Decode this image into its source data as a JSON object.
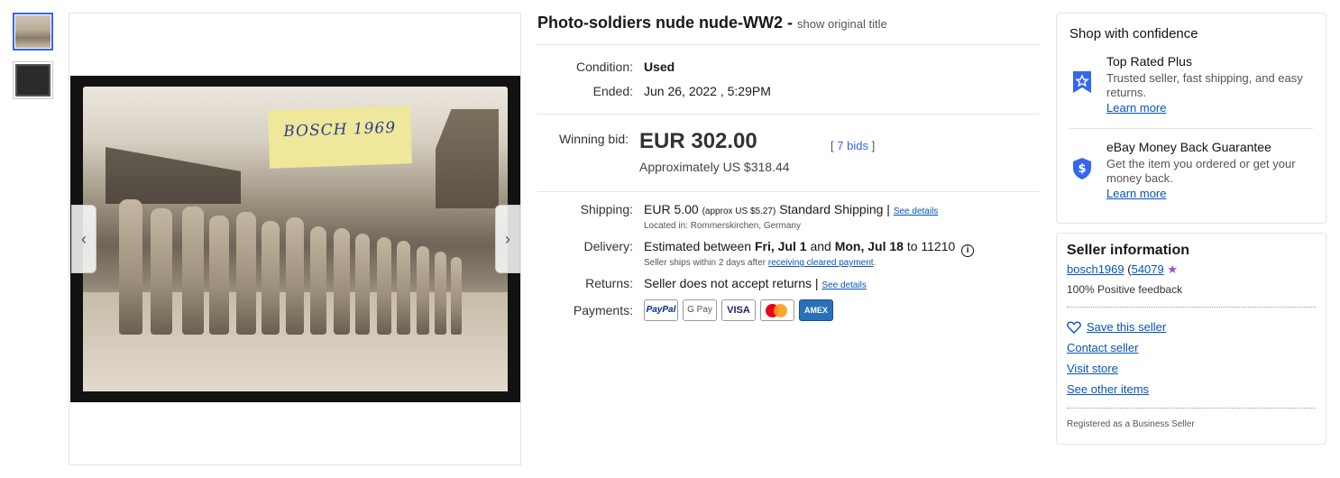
{
  "listing": {
    "title": "Photo-soldiers nude nude-WW2 -",
    "show_original_title": "show original title",
    "photo_caption": "BOSCH 1969"
  },
  "details": {
    "condition_label": "Condition:",
    "condition_value": "Used",
    "ended_label": "Ended:",
    "ended_value": "Jun 26, 2022 , 5:29PM"
  },
  "bid": {
    "label": "Winning bid:",
    "price": "EUR 302.00",
    "approx": "Approximately US $318.44",
    "bids_open": "[",
    "bids_text": "7 bids",
    "bids_close": "]"
  },
  "shipping": {
    "label": "Shipping:",
    "cost": "EUR 5.00",
    "approx": "(approx US $5.27)",
    "method": "Standard Shipping |",
    "see_details": "See details",
    "located": "Located in: Rommerskirchen, Germany"
  },
  "delivery": {
    "label": "Delivery:",
    "text1": "Estimated between",
    "date1": "Fri, Jul 1",
    "text2": "and",
    "date2": "Mon, Jul 18",
    "text3": "to 11210",
    "info_icon": "i",
    "note": "Seller ships within 2 days after",
    "note_link": "receiving cleared payment",
    "note_end": "."
  },
  "returns": {
    "label": "Returns:",
    "text": "Seller does not accept returns |",
    "see_details": "See details"
  },
  "payments": {
    "label": "Payments:",
    "methods": [
      "PayPal",
      "G Pay",
      "VISA",
      "",
      "AMEX"
    ]
  },
  "confidence": {
    "title": "Shop with confidence",
    "items": [
      {
        "title": "Top Rated Plus",
        "desc": "Trusted seller, fast shipping, and easy returns.",
        "link": "Learn more"
      },
      {
        "title": "eBay Money Back Guarantee",
        "desc": "Get the item you ordered or get your money back.",
        "link": "Learn more"
      }
    ]
  },
  "seller": {
    "title": "Seller information",
    "username": "bosch1969",
    "score_open": "(",
    "score": "54079",
    "feedback": "100% Positive feedback",
    "save": "Save this seller",
    "contact": "Contact seller",
    "store": "Visit store",
    "other": "See other items",
    "registered": "Registered as a Business Seller"
  },
  "colors": {
    "link": "#0654ba",
    "accent": "#3665f3",
    "star": "#9d4ed8"
  }
}
